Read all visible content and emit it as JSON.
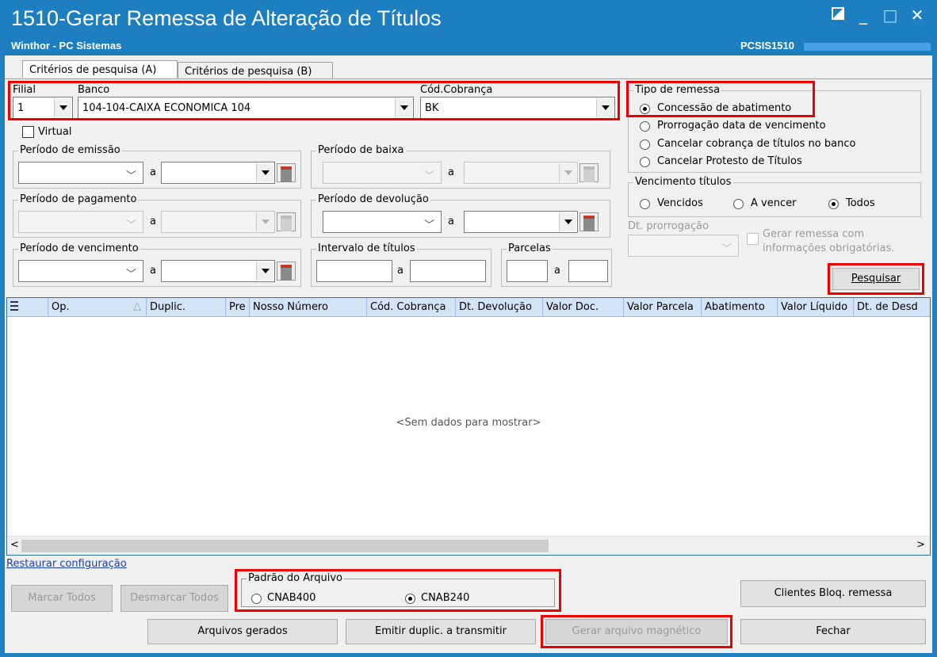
{
  "window": {
    "title": "1510-Gerar Remessa de Alteração de Títulos",
    "subtitle": "Winthor - PC Sistemas",
    "code": "PCSIS1510",
    "minimize": "_",
    "maximize": "□",
    "close": "✕"
  },
  "tabs": [
    "Critérios de pesquisa (A)",
    "Critérios de pesquisa (B)"
  ],
  "filters": {
    "filial_label": "Filial",
    "filial_value": "1",
    "banco_label": "Banco",
    "banco_value": "104-104-CAIXA ECONOMICA 104",
    "cod_cobranca_label": "Cód.Cobrança",
    "cod_cobranca_value": "BK",
    "virtual_label": "Virtual",
    "separator": "a",
    "periodo_emissao": "Período de emissão",
    "periodo_baixa": "Período de baixa",
    "periodo_pagamento": "Período de pagamento",
    "periodo_devolucao": "Período de devolução",
    "periodo_vencimento": "Período de vencimento",
    "intervalo_titulos": "Intervalo de títulos",
    "parcelas": "Parcelas"
  },
  "tipo_remessa": {
    "title": "Tipo de remessa",
    "options": [
      "Concessão de abatimento",
      "Prorrogação data de vencimento",
      "Cancelar cobrança de títulos no banco",
      "Cancelar Protesto de Títulos"
    ],
    "selected": 0
  },
  "vencimento": {
    "title": "Vencimento títulos",
    "options": [
      "Vencidos",
      "A vencer",
      "Todos"
    ],
    "selected": 2
  },
  "dt_prorrogacao_label": "Dt. prorrogação",
  "gerar_remessa_label_1": "Gerar remessa com",
  "gerar_remessa_label_2": "informações obrigatórias.",
  "pesquisar_label": "Pesquisar",
  "grid": {
    "columns": [
      "Op.",
      "Duplic.",
      "Pre",
      "Nosso Número",
      "Cód. Cobrança",
      "Dt. Devolução",
      "Valor Doc.",
      "Valor Parcela",
      "Abatimento",
      "Valor Líquido",
      "Dt. de Desd"
    ],
    "empty_text": "<Sem dados para mostrar>"
  },
  "restaurar_label": "Restaurar configuração",
  "padrao_arquivo": {
    "title": "Padrão do Arquivo",
    "options": [
      "CNAB400",
      "CNAB240"
    ],
    "selected": 1
  },
  "buttons": {
    "marcar_todos": "Marcar Todos",
    "desmarcar_todos": "Desmarcar Todos",
    "clientes_bloq": "Clientes Bloq. remessa",
    "arquivos_gerados": "Arquivos gerados",
    "emitir_duplic": "Emitir duplic. a transmitir",
    "gerar_arquivo": "Gerar arquivo magnético",
    "fechar": "Fechar"
  },
  "colors": {
    "title_bar": "#1e7fc0",
    "highlight": "#e00000",
    "grid_header": "#d4e4f7"
  }
}
